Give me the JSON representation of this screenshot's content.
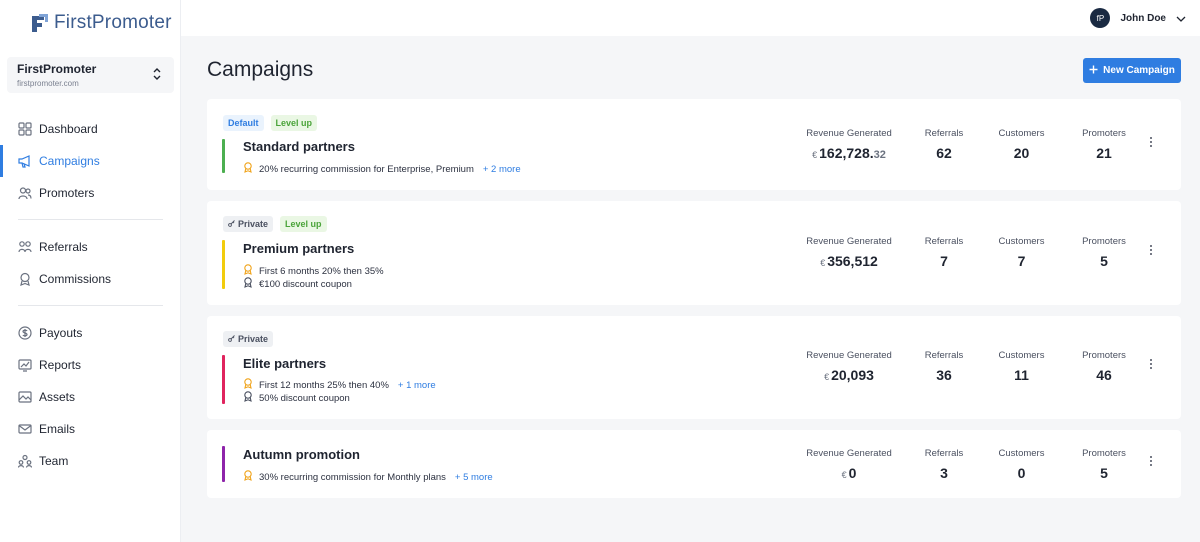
{
  "app": {
    "logo_text": "FirstPromoter",
    "brand_color": "#2f7de1"
  },
  "workspace": {
    "name": "FirstPromoter",
    "domain": "firstpromoter.com"
  },
  "sidebar": {
    "group1": [
      {
        "label": "Dashboard",
        "icon": "dashboard-icon"
      },
      {
        "label": "Campaigns",
        "icon": "megaphone-icon",
        "active": true
      },
      {
        "label": "Promoters",
        "icon": "users-icon"
      }
    ],
    "group2": [
      {
        "label": "Referrals",
        "icon": "referrals-icon"
      },
      {
        "label": "Commissions",
        "icon": "award-icon"
      }
    ],
    "group3": [
      {
        "label": "Payouts",
        "icon": "dollar-icon"
      },
      {
        "label": "Reports",
        "icon": "reports-icon"
      },
      {
        "label": "Assets",
        "icon": "image-icon"
      },
      {
        "label": "Emails",
        "icon": "mail-icon"
      },
      {
        "label": "Team",
        "icon": "team-icon"
      }
    ]
  },
  "topbar": {
    "user_name": "John Doe",
    "avatar_initials": "fP"
  },
  "page": {
    "title": "Campaigns",
    "new_button": "New Campaign"
  },
  "stat_labels": {
    "revenue": "Revenue Generated",
    "referrals": "Referrals",
    "customers": "Customers",
    "promoters": "Promoters"
  },
  "campaigns": [
    {
      "badges": [
        {
          "label": "Default",
          "type": "default"
        },
        {
          "label": "Level up",
          "type": "level"
        }
      ],
      "name": "Standard partners",
      "accent": "#4caf50",
      "perks": [
        {
          "text": "20% recurring commission for Enterprise, Premium",
          "more": "+ 2 more"
        }
      ],
      "revenue_currency": "€",
      "revenue_int": "162,728.",
      "revenue_dec": "32",
      "referrals": "62",
      "customers": "20",
      "promoters": "21"
    },
    {
      "badges": [
        {
          "label": "Private",
          "type": "private"
        },
        {
          "label": "Level up",
          "type": "level"
        }
      ],
      "name": "Premium partners",
      "accent": "#f2cc0c",
      "perks": [
        {
          "text": "First 6 months 20% then 35%",
          "more": ""
        },
        {
          "text": "€100 discount coupon",
          "more": ""
        }
      ],
      "revenue_currency": "€",
      "revenue_int": "356,512",
      "revenue_dec": "",
      "referrals": "7",
      "customers": "7",
      "promoters": "5"
    },
    {
      "badges": [
        {
          "label": "Private",
          "type": "private"
        }
      ],
      "name": "Elite partners",
      "accent": "#e0245e",
      "perks": [
        {
          "text": "First 12 months 25% then 40%",
          "more": "+ 1 more"
        },
        {
          "text": "50% discount coupon",
          "more": ""
        }
      ],
      "revenue_currency": "€",
      "revenue_int": "20,093",
      "revenue_dec": "",
      "referrals": "36",
      "customers": "11",
      "promoters": "46"
    },
    {
      "badges": [],
      "name": "Autumn promotion",
      "accent": "#8e24aa",
      "perks": [
        {
          "text": "30% recurring commission for Monthly plans",
          "more": "+ 5 more"
        }
      ],
      "revenue_currency": "€",
      "revenue_int": "0",
      "revenue_dec": "",
      "referrals": "3",
      "customers": "0",
      "promoters": "5"
    }
  ]
}
